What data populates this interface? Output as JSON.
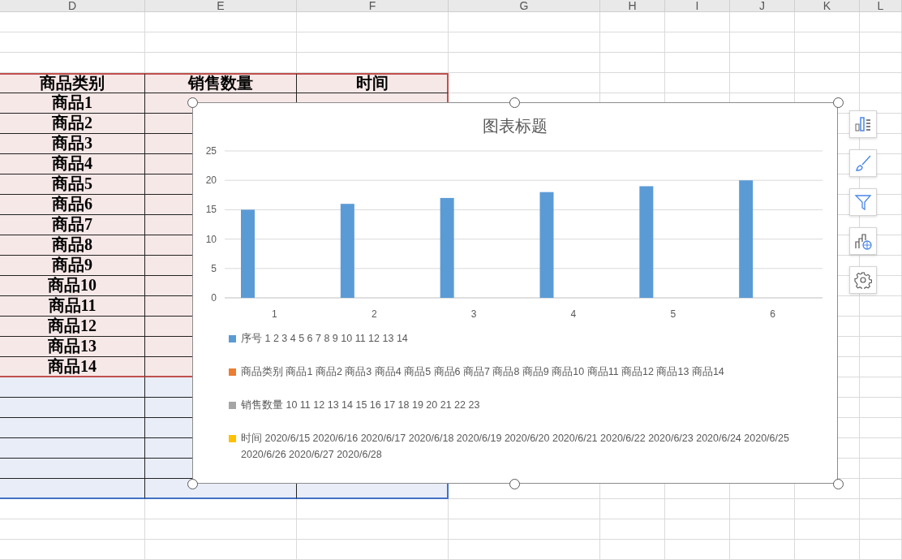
{
  "columns": [
    "D",
    "E",
    "F",
    "G",
    "H",
    "I",
    "J",
    "K",
    "L"
  ],
  "table": {
    "header": [
      "商品类别",
      "销售数量",
      "时间"
    ],
    "rows": [
      {
        "category": "商品1"
      },
      {
        "category": "商品2"
      },
      {
        "category": "商品3"
      },
      {
        "category": "商品4"
      },
      {
        "category": "商品5"
      },
      {
        "category": "商品6"
      },
      {
        "category": "商品7"
      },
      {
        "category": "商品8"
      },
      {
        "category": "商品9"
      },
      {
        "category": "商品10"
      },
      {
        "category": "商品11"
      },
      {
        "category": "商品12"
      },
      {
        "category": "商品13"
      },
      {
        "category": "商品14"
      }
    ],
    "extension_rows": [
      {
        "kind": "blank"
      },
      {
        "kind": "blank"
      },
      {
        "kind": "blank"
      },
      {
        "kind": "blank"
      },
      {
        "kind": "blank"
      },
      {
        "kind": "blank"
      }
    ]
  },
  "chart": {
    "chart_data": {
      "type": "bar",
      "grid": true,
      "title": "图表标题",
      "categories": [
        "1",
        "2",
        "3",
        "4",
        "5",
        "6"
      ],
      "ylim": [
        0,
        25
      ],
      "yticks": [
        0,
        5,
        10,
        15,
        20,
        25
      ],
      "series": [
        {
          "name": "序号 1 2 3 4 5 6 7 8 9 10 11 12 13 14",
          "color": "#5b9bd5",
          "values": [
            15,
            16,
            17,
            18,
            19,
            20
          ]
        },
        {
          "name": "商品类别 商品1 商品2 商品3 商品4 商品5 商品6 商品7 商品8 商品9 商品10 商品11 商品12 商品13 商品14",
          "color": "#ed7d31",
          "values": [
            null,
            null,
            null,
            null,
            null,
            null
          ]
        },
        {
          "name": "销售数量 10 11 12 13 14 15 16 17 18 19 20 21 22 23",
          "color": "#a5a5a5",
          "values": [
            null,
            null,
            null,
            null,
            null,
            null
          ]
        },
        {
          "name": "时间 2020/6/15 2020/6/16 2020/6/17 2020/6/18 2020/6/19 2020/6/20 2020/6/21 2020/6/22 2020/6/23 2020/6/24 2020/6/25 2020/6/26 2020/6/27 2020/6/28",
          "color": "#ffc000",
          "values": [
            null,
            null,
            null,
            null,
            null,
            null
          ]
        }
      ]
    }
  }
}
